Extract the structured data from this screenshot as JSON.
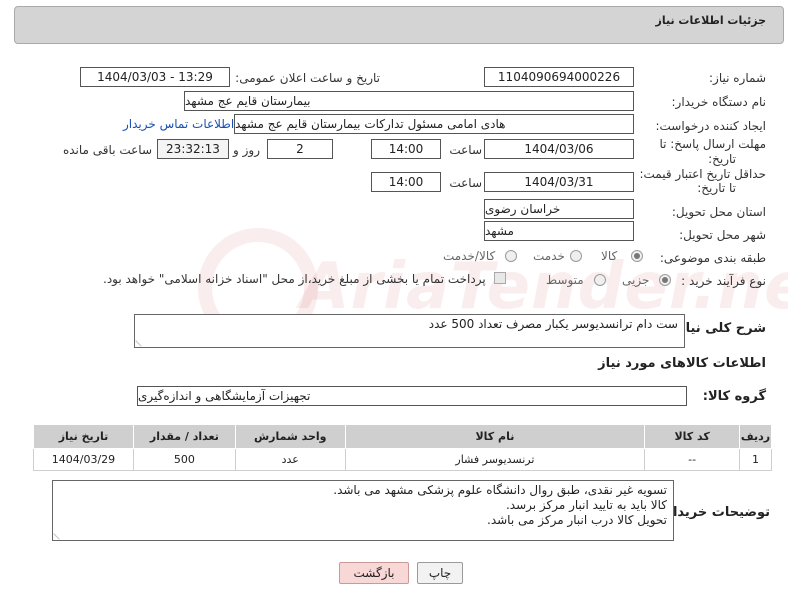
{
  "page": {
    "title": "جزئیات اطلاعات نیاز"
  },
  "form": {
    "need_number_label": "شماره نیاز:",
    "need_number": "1104090694000226",
    "announce_label": "تاریخ و ساعت اعلان عمومی:",
    "announce_value": "1404/03/03 - 13:29",
    "buyer_org_label": "نام دستگاه خریدار:",
    "buyer_org": "بیمارستان قایم  عج  مشهد",
    "creator_label": "ایجاد کننده درخواست:",
    "creator": "هادی امامی مسئول تدارکات بیمارستان قایم  عج  مشهد",
    "contact_link": "اطلاعات تماس خریدار",
    "reply_deadline_label_1": "مهلت ارسال پاسخ: تا",
    "reply_deadline_label_2": "تاریخ:",
    "reply_date": "1404/03/06",
    "time_label": "ساعت",
    "reply_time": "14:00",
    "days_value": "2",
    "days_label": "روز و",
    "remaining_value": "23:32:13",
    "remaining_label": "ساعت باقی مانده",
    "price_validity_label_1": "حداقل تاریخ اعتبار قیمت:",
    "price_validity_label_2": "تا تاریخ:",
    "price_date": "1404/03/31",
    "price_time": "14:00",
    "province_label": "استان محل تحویل:",
    "province": "خراسان رضوی",
    "city_label": "شهر محل تحویل:",
    "city": "مشهد",
    "category_label": "طبقه بندی موضوعی:",
    "category_options": [
      "کالا",
      "خدمت",
      "کالا/خدمت"
    ],
    "category_selected": "کالا",
    "process_label": "نوع فرآیند خرید :",
    "process_options": [
      "جزیی",
      "متوسط"
    ],
    "process_selected": "جزیی",
    "payment_note": "پرداخت تمام یا بخشی از مبلغ خرید،از محل \"اسناد خزانه اسلامی\" خواهد بود.",
    "description_label": "شرح کلی نیاز:",
    "description": "ست دام ترانسدیوسر یکبار مصرف تعداد 500 عدد"
  },
  "goods": {
    "section_title": "اطلاعات کالاهای مورد نیاز",
    "group_label": "گروه کالا:",
    "group_value": "تجهیزات آزمایشگاهی و اندازه‌گیری",
    "columns": [
      "ردیف",
      "کد کالا",
      "نام کالا",
      "واحد شمارش",
      "تعداد / مقدار",
      "تاریخ نیاز"
    ],
    "rows": [
      [
        "1",
        "--",
        "ترنسدیوسر فشار",
        "عدد",
        "500",
        "1404/03/29"
      ]
    ]
  },
  "buyer_notes": {
    "label": "توضیحات خریدار:",
    "lines": [
      "تسویه غیر نقدی، طبق روال دانشگاه علوم پزشکی مشهد می باشد.",
      "کالا باید به تایید انبار مرکز برسد.",
      "تحویل کالا درب انبار مرکز می باشد."
    ]
  },
  "buttons": {
    "print": "چاپ",
    "back": "بازگشت"
  },
  "watermark": {
    "text": "AriaTender.neT"
  },
  "colors": {
    "title_bar": "#d4d4d4",
    "table_header": "#cfcfcf",
    "link": "#1a4fb5",
    "back_button": "#f8d7d7"
  }
}
